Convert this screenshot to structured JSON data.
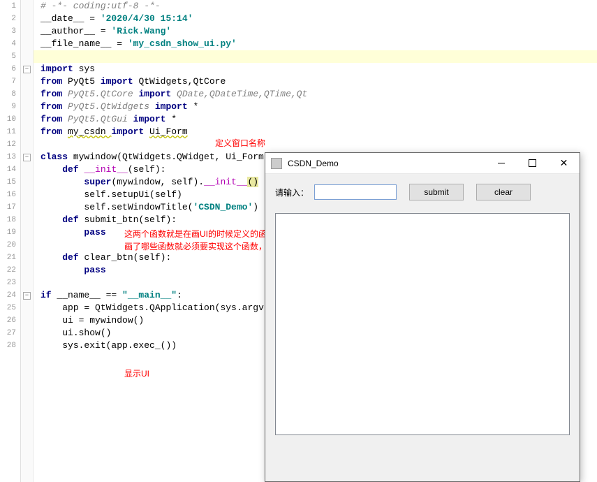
{
  "gutter": {
    "lines": [
      "1",
      "2",
      "3",
      "4",
      "5",
      "6",
      "7",
      "8",
      "9",
      "10",
      "11",
      "12",
      "13",
      "14",
      "15",
      "16",
      "17",
      "18",
      "19",
      "20",
      "21",
      "22",
      "23",
      "24",
      "25",
      "26",
      "27",
      "28"
    ]
  },
  "code": {
    "l1_comment": "# -*- coding:utf-8 -*-",
    "l2_a": "__date__ = ",
    "l2_b": "'2020/4/30 15:14'",
    "l3_a": "__author__ = ",
    "l3_b": "'Rick.Wang'",
    "l4_a": "__file_name__ = ",
    "l4_b": "'my_csdn_show_ui.py'",
    "l6_a": "import ",
    "l6_b": "sys",
    "l7_a": "from ",
    "l7_b": "PyQt5 ",
    "l7_c": "import ",
    "l7_d": "QtWidgets,QtCore",
    "l8_a": "from ",
    "l8_b": "PyQt5.QtCore ",
    "l8_c": "import ",
    "l8_d": "QDate,QDateTime,QTime,Qt",
    "l9_a": "from ",
    "l9_b": "PyQt5.QtWidgets ",
    "l9_c": "import ",
    "l9_d": "*",
    "l10_a": "from ",
    "l10_b": "PyQt5.QtGui ",
    "l10_c": "import ",
    "l10_d": "*",
    "l11_a": "from ",
    "l11_b": "my_csdn ",
    "l11_c": "import ",
    "l11_d": "Ui_Form",
    "l13_a": "class ",
    "l13_b": "mywindow(QtWidgets.QWidget, Ui_Form):",
    "l14_a": "def ",
    "l14_b": "__init__",
    "l14_c": "(self):",
    "l15_a": "super",
    "l15_b": "(mywindow, self).",
    "l15_c": "__init__",
    "l15_d": "(",
    "l15_e": ")",
    "l16_a": "self.setupUi(self)",
    "l17_a": "self.setWindowTitle(",
    "l17_b": "'CSDN_Demo'",
    "l17_c": ")",
    "l18_a": "def ",
    "l18_b": "submit_btn(self):",
    "l19_a": "pass",
    "l21_a": "def ",
    "l21_b": "clear_btn(self):",
    "l22_a": "pass",
    "l24_a": "if ",
    "l24_b": "__name__ == ",
    "l24_c": "\"__main__\"",
    "l24_d": ":",
    "l25_a": "app = QtWidgets.QApplication(sys.argv)",
    "l26_a": "ui = mywindow()",
    "l27_a": "ui.show()",
    "l28_a": "sys.exit(app.exec_())"
  },
  "annotations": {
    "a1": "定义窗口名称",
    "a2a": "这两个函数就是在画UI的时候定义的函数，",
    "a2b": "画了哪些函数就必须要实现这个函数，否则在运行的时候会报错缺少对应的函数",
    "a3": "显示UI"
  },
  "window": {
    "title": "CSDN_Demo",
    "label": "请输入：",
    "input_value": "",
    "submit": "submit",
    "clear": "clear",
    "close_glyph": "✕"
  }
}
